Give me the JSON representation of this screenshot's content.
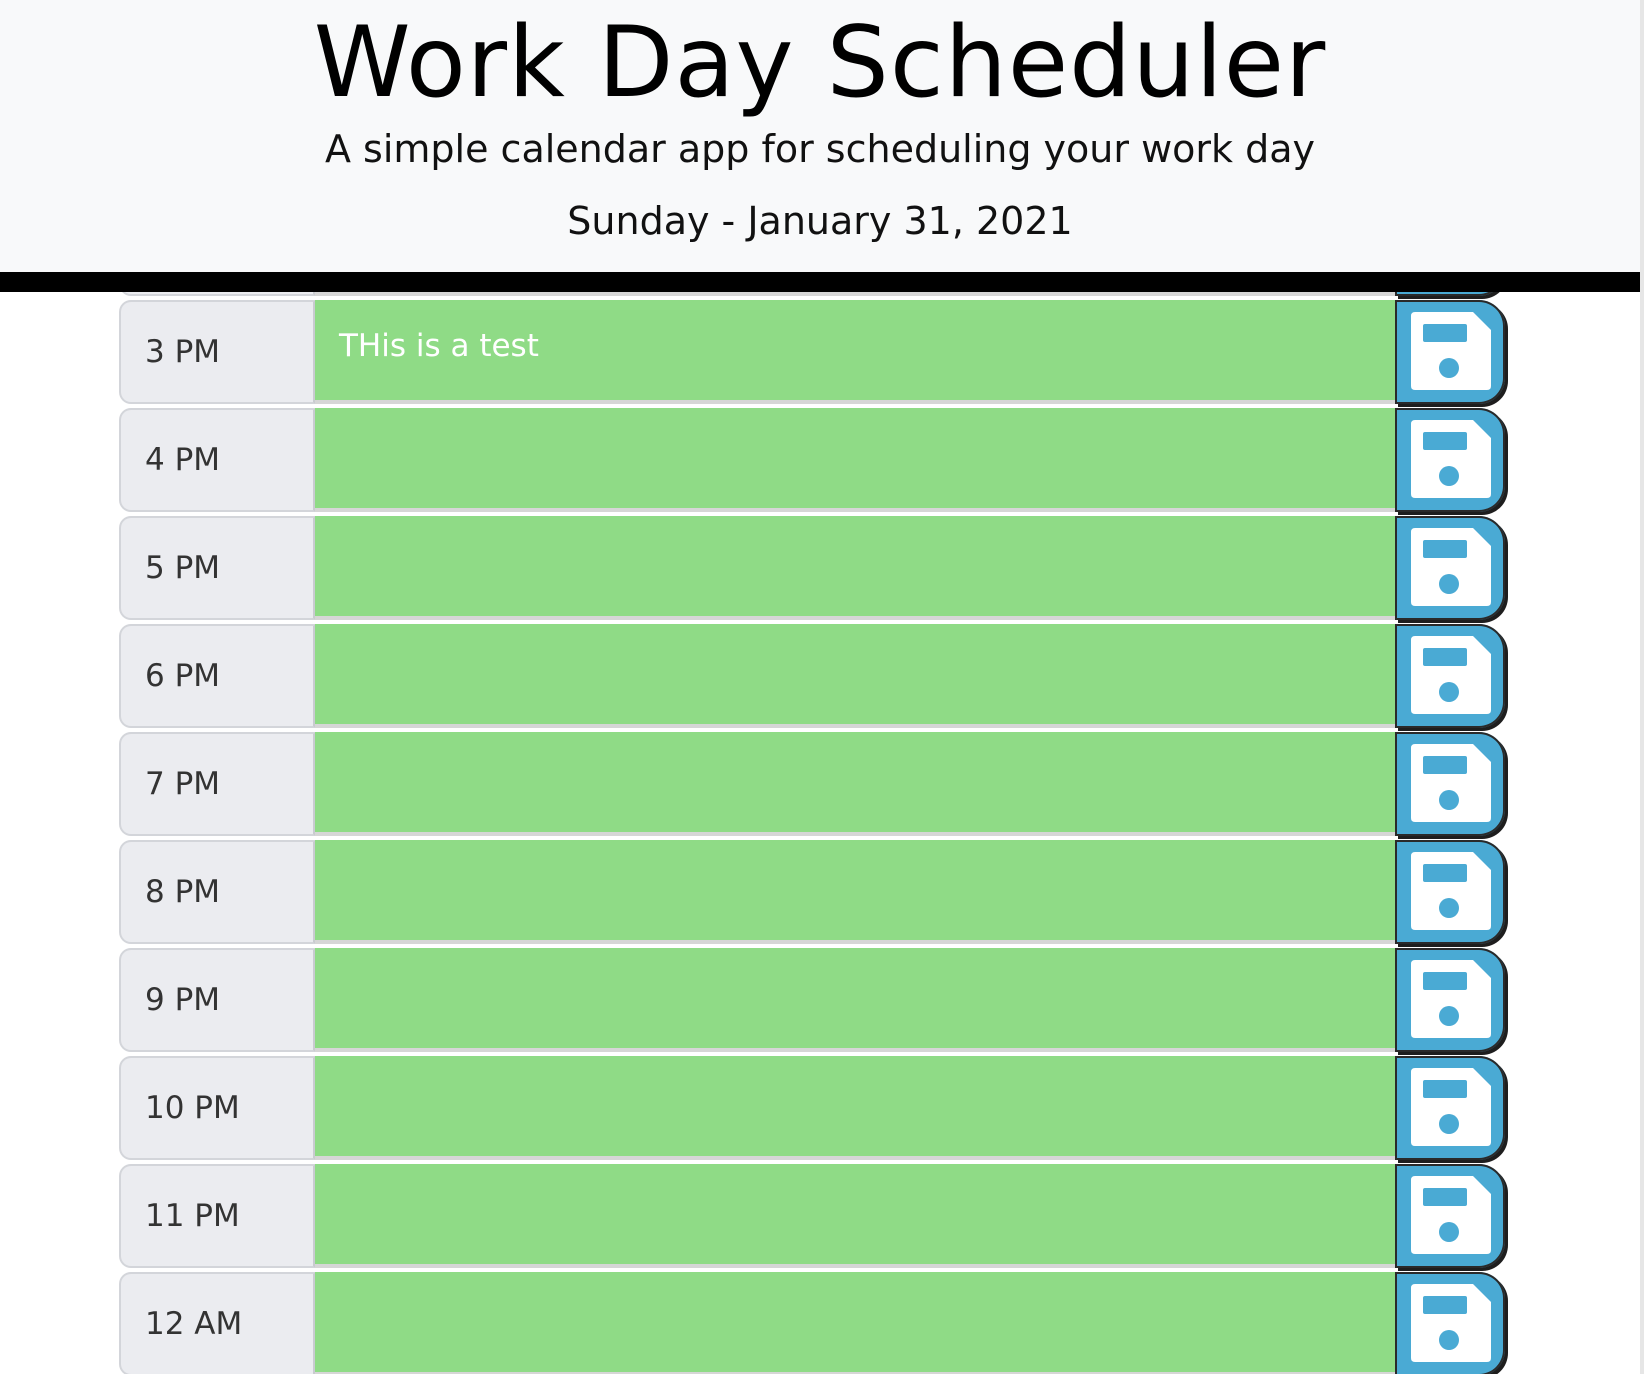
{
  "header": {
    "title": "Work Day Scheduler",
    "lead": "A simple calendar app for scheduling your work day",
    "current_day": "Sunday - January 31, 2021"
  },
  "colors": {
    "header_bg": "#f8f9fa",
    "header_border": "#000000",
    "hour_bg": "#ebecf0",
    "present_or_future": "#8fdb86",
    "past_peek": "#f08a80",
    "save_button": "#4aaad4"
  },
  "icons": {
    "save": "floppy-disk-icon"
  },
  "timeblocks": [
    {
      "hour": "3 PM",
      "text": "THis is a test"
    },
    {
      "hour": "4 PM",
      "text": ""
    },
    {
      "hour": "5 PM",
      "text": ""
    },
    {
      "hour": "6 PM",
      "text": ""
    },
    {
      "hour": "7 PM",
      "text": ""
    },
    {
      "hour": "8 PM",
      "text": ""
    },
    {
      "hour": "9 PM",
      "text": ""
    },
    {
      "hour": "10 PM",
      "text": ""
    },
    {
      "hour": "11 PM",
      "text": ""
    },
    {
      "hour": "12 AM",
      "text": ""
    }
  ]
}
